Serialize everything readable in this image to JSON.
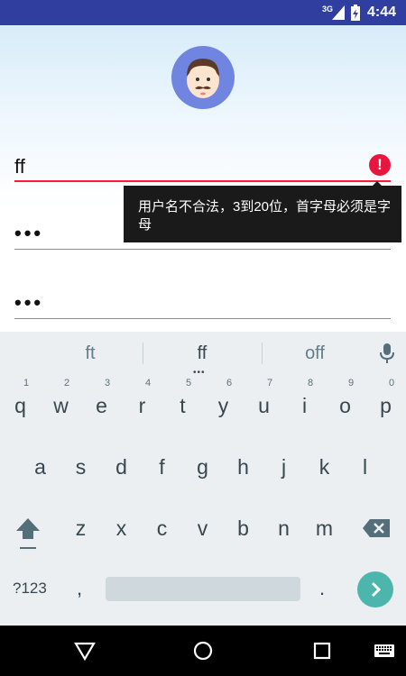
{
  "status_bar": {
    "network": "3G",
    "time": "4:44"
  },
  "form": {
    "username_value": "ff",
    "password_mask": "•••",
    "confirm_mask": "•••",
    "error_message": "用户名不合法，3到20位，首字母必须是字母"
  },
  "keyboard": {
    "suggestions": [
      "ft",
      "ff",
      "off"
    ],
    "row1": [
      {
        "key": "q",
        "hint": "1"
      },
      {
        "key": "w",
        "hint": "2"
      },
      {
        "key": "e",
        "hint": "3"
      },
      {
        "key": "r",
        "hint": "4"
      },
      {
        "key": "t",
        "hint": "5"
      },
      {
        "key": "y",
        "hint": "6"
      },
      {
        "key": "u",
        "hint": "7"
      },
      {
        "key": "i",
        "hint": "8"
      },
      {
        "key": "o",
        "hint": "9"
      },
      {
        "key": "p",
        "hint": "0"
      }
    ],
    "row2": [
      "a",
      "s",
      "d",
      "f",
      "g",
      "h",
      "j",
      "k",
      "l"
    ],
    "row3": [
      "z",
      "x",
      "c",
      "v",
      "b",
      "n",
      "m"
    ],
    "symbols_label": "?123",
    "comma": ",",
    "period": "."
  },
  "colors": {
    "status_bar": "#303F9F",
    "error": "#E8163F",
    "enter_key": "#4DB6AC",
    "avatar_bg": "#6F85E0"
  },
  "icons": [
    "signal-icon",
    "battery-icon",
    "avatar-icon",
    "error-icon",
    "mic-icon",
    "shift-icon",
    "backspace-icon",
    "enter-icon",
    "back-icon",
    "home-icon",
    "recents-icon",
    "keyboard-icon"
  ]
}
